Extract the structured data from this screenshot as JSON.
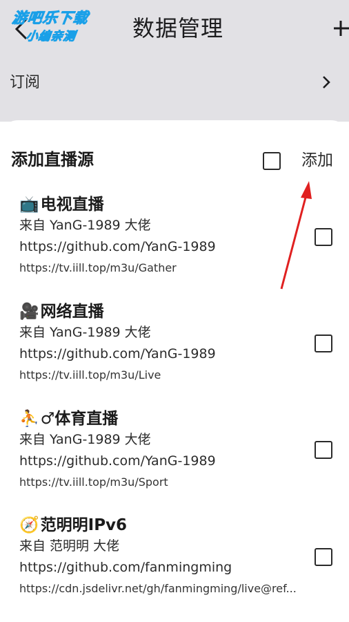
{
  "appbar": {
    "title": "数据管理",
    "back_icon": "back-arrow-icon",
    "add_icon": "plus-icon"
  },
  "watermark": {
    "line1": "游吧乐下载",
    "line2": "小编亲测"
  },
  "subscription_row": {
    "label": "订阅",
    "chevron_icon": "chevron-right-icon"
  },
  "sheet": {
    "title": "添加直播源",
    "add_label": "添加",
    "items": [
      {
        "emoji": "📺",
        "name": "电视直播",
        "desc": "来自 YanG-1989 大佬 https://github.com/YanG-1989",
        "url": "https://tv.iill.top/m3u/Gather"
      },
      {
        "emoji": "🎥",
        "name": "网络直播",
        "desc": "来自 YanG-1989 大佬 https://github.com/YanG-1989",
        "url": "https://tv.iill.top/m3u/Live"
      },
      {
        "emoji": "⛹",
        "name": "♂体育直播",
        "desc": "来自 YanG-1989 大佬 https://github.com/YanG-1989",
        "url": "https://tv.iill.top/m3u/Sport"
      },
      {
        "emoji": "🧭",
        "name": "范明明IPv6",
        "desc": "来自 范明明 大佬 https://github.com/fanmingming",
        "url": "https://cdn.jsdelivr.net/gh/fanmingming/live@ref..."
      }
    ]
  },
  "colors": {
    "appbar_bg": "#e2e1e5",
    "sheet_bg": "#ffffff",
    "annotation_arrow": "#e02020"
  }
}
